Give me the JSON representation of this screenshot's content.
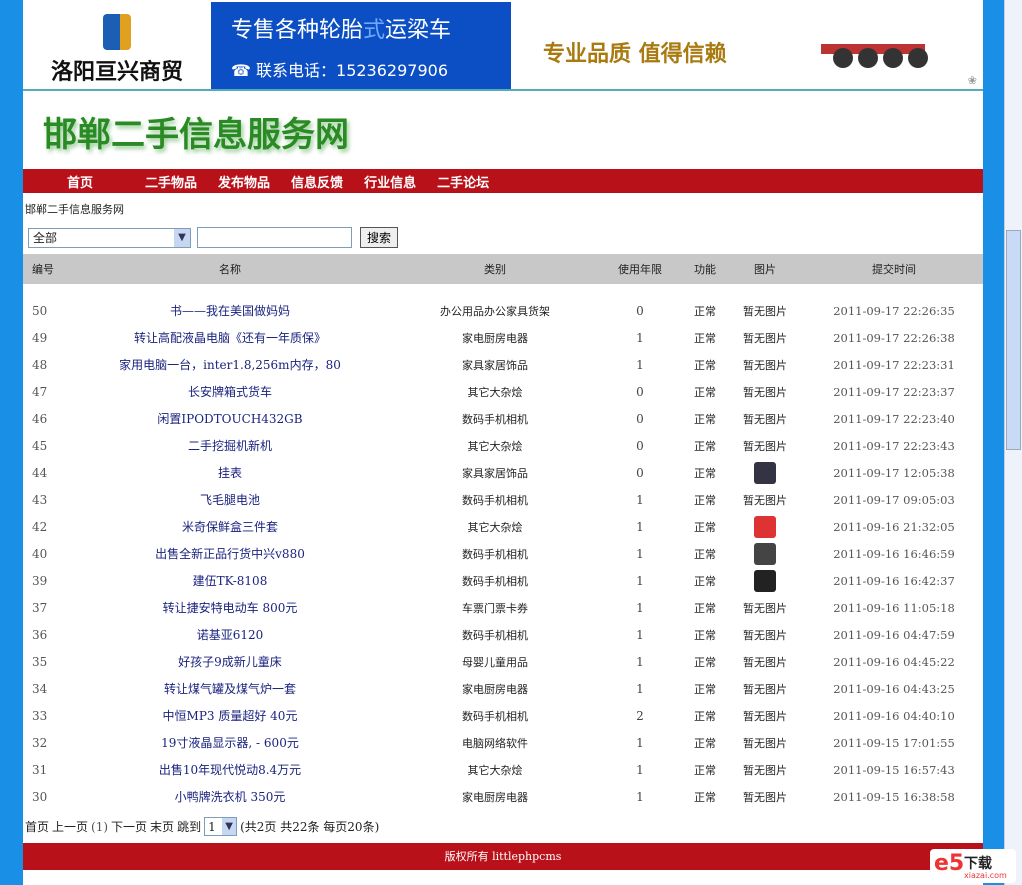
{
  "banner": {
    "company": "洛阳亘兴商贸",
    "ad_line1_a": "专售各种轮胎",
    "ad_line1_b": "式",
    "ad_line1_c": "运梁车",
    "phone": "☎ 联系电话：15236297906",
    "slogan": "专业品质  值得信赖"
  },
  "site_title": "邯郸二手信息服务网",
  "nav": [
    "首页",
    "二手物品",
    "发布物品",
    "信息反馈",
    "行业信息",
    "二手论坛"
  ],
  "breadcrumb": "邯郸二手信息服务网",
  "search": {
    "category": "全部",
    "query": "",
    "button": "搜索"
  },
  "columns": [
    "编号",
    "名称",
    "类别",
    "使用年限",
    "功能",
    "图片",
    "提交时间"
  ],
  "rows": [
    {
      "id": "50",
      "name": "书——我在美国做妈妈",
      "cat": "办公用品办公家具货架",
      "years": "0",
      "func": "正常",
      "pic": "暂无图片",
      "time": "2011-09-17 22:26:35"
    },
    {
      "id": "49",
      "name": "转让高配液晶电脑《还有一年质保》",
      "cat": "家电厨房电器",
      "years": "1",
      "func": "正常",
      "pic": "暂无图片",
      "time": "2011-09-17 22:26:38"
    },
    {
      "id": "48",
      "name": "家用电脑一台，inter1.8,256m内存，80",
      "cat": "家具家居饰品",
      "years": "1",
      "func": "正常",
      "pic": "暂无图片",
      "time": "2011-09-17 22:23:31"
    },
    {
      "id": "47",
      "name": "长安牌箱式货车",
      "cat": "其它大杂烩",
      "years": "0",
      "func": "正常",
      "pic": "暂无图片",
      "time": "2011-09-17 22:23:37"
    },
    {
      "id": "46",
      "name": "闲置IPODTOUCH432GB",
      "cat": "数码手机相机",
      "years": "0",
      "func": "正常",
      "pic": "暂无图片",
      "time": "2011-09-17 22:23:40"
    },
    {
      "id": "45",
      "name": "二手挖掘机新机",
      "cat": "其它大杂烩",
      "years": "0",
      "func": "正常",
      "pic": "暂无图片",
      "time": "2011-09-17 22:23:43"
    },
    {
      "id": "44",
      "name": "挂表",
      "cat": "家具家居饰品",
      "years": "0",
      "func": "正常",
      "pic": "",
      "thumb": "#334",
      "time": "2011-09-17 12:05:38"
    },
    {
      "id": "43",
      "name": "飞毛腿电池",
      "cat": "数码手机相机",
      "years": "1",
      "func": "正常",
      "pic": "暂无图片",
      "time": "2011-09-17 09:05:03"
    },
    {
      "id": "42",
      "name": "米奇保鲜盒三件套",
      "cat": "其它大杂烩",
      "years": "1",
      "func": "正常",
      "pic": "",
      "thumb": "#d33",
      "time": "2011-09-16 21:32:05"
    },
    {
      "id": "40",
      "name": "出售全新正品行货中兴v880",
      "cat": "数码手机相机",
      "years": "1",
      "func": "正常",
      "pic": "",
      "thumb": "#444",
      "time": "2011-09-16 16:46:59"
    },
    {
      "id": "39",
      "name": "建伍TK-8108",
      "cat": "数码手机相机",
      "years": "1",
      "func": "正常",
      "pic": "",
      "thumb": "#222",
      "time": "2011-09-16 16:42:37"
    },
    {
      "id": "37",
      "name": "转让捷安特电动车 800元",
      "cat": "车票门票卡券",
      "years": "1",
      "func": "正常",
      "pic": "暂无图片",
      "time": "2011-09-16 11:05:18"
    },
    {
      "id": "36",
      "name": "诺基亚6120",
      "cat": "数码手机相机",
      "years": "1",
      "func": "正常",
      "pic": "暂无图片",
      "time": "2011-09-16 04:47:59"
    },
    {
      "id": "35",
      "name": "好孩子9成新儿童床",
      "cat": "母婴儿童用品",
      "years": "1",
      "func": "正常",
      "pic": "暂无图片",
      "time": "2011-09-16 04:45:22"
    },
    {
      "id": "34",
      "name": "转让煤气罐及煤气炉一套",
      "cat": "家电厨房电器",
      "years": "1",
      "func": "正常",
      "pic": "暂无图片",
      "time": "2011-09-16 04:43:25"
    },
    {
      "id": "33",
      "name": "中恒MP3 质量超好 40元",
      "cat": "数码手机相机",
      "years": "2",
      "func": "正常",
      "pic": "暂无图片",
      "time": "2011-09-16 04:40:10"
    },
    {
      "id": "32",
      "name": "19寸液晶显示器, - 600元",
      "cat": "电脑网络软件",
      "years": "1",
      "func": "正常",
      "pic": "暂无图片",
      "time": "2011-09-15 17:01:55"
    },
    {
      "id": "31",
      "name": "出售10年现代悦动8.4万元",
      "cat": "其它大杂烩",
      "years": "1",
      "func": "正常",
      "pic": "暂无图片",
      "time": "2011-09-15 16:57:43"
    },
    {
      "id": "30",
      "name": "小鸭牌洗衣机 350元",
      "cat": "家电厨房电器",
      "years": "1",
      "func": "正常",
      "pic": "暂无图片",
      "time": "2011-09-15 16:38:58"
    }
  ],
  "pager": {
    "first": "首页",
    "prev": "上一页",
    "current": "(1)",
    "next": "下一页",
    "last": "末页",
    "jump": "跳到",
    "page": "1",
    "summary": "(共2页 共22条 每页20条)"
  },
  "footer": "版权所有 littlephpcms",
  "watermark": {
    "logo": "e5",
    "text": "下载",
    "url": "xiazai.com"
  }
}
